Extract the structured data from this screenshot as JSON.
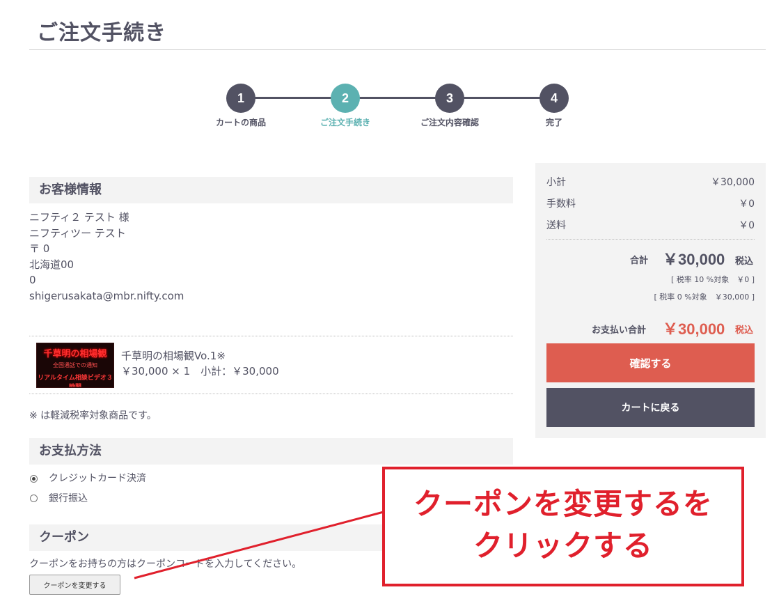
{
  "page": {
    "title": "ご注文手続き"
  },
  "stepper": {
    "steps": [
      {
        "num": "1",
        "label": "カートの商品"
      },
      {
        "num": "2",
        "label": "ご注文手続き"
      },
      {
        "num": "3",
        "label": "ご注文内容確認"
      },
      {
        "num": "4",
        "label": "完了"
      }
    ],
    "active_index": 1
  },
  "customer": {
    "heading": "お客様情報",
    "lines": [
      "ニフティ２ テスト 様",
      "ニフティツー テスト",
      "〒 0",
      "北海道00",
      "0",
      "shigerusakata@mbr.nifty.com"
    ]
  },
  "product": {
    "thumb_title": "千草明の相場観",
    "thumb_sub": "全国通話での通知",
    "thumb_bottom": "リアルタイム相談ビデオ３時間",
    "name": "千草明の相場観Vo.1※",
    "price_line": "￥30,000 × 1　小計：￥30,000",
    "note": "※ は軽減税率対象商品です。"
  },
  "payment": {
    "heading": "お支払方法",
    "options": [
      {
        "label": "クレジットカード決済",
        "checked": true
      },
      {
        "label": "銀行振込",
        "checked": false
      }
    ]
  },
  "coupon": {
    "heading": "クーポン",
    "description": "クーポンをお持ちの方はクーポンコードを入力してください。",
    "button_label": "クーポンを変更する"
  },
  "summary": {
    "subtotal_label": "小計",
    "subtotal_value": "￥30,000",
    "fee_label": "手数料",
    "fee_value": "￥0",
    "shipping_label": "送料",
    "shipping_value": "￥0",
    "total_label": "合計",
    "total_value": "￥30,000",
    "total_suffix": "税込",
    "tax10": "[ 税率 10 %対象　￥0 ]",
    "tax0": "[ 税率 0 %対象　￥30,000 ]",
    "pay_total_label": "お支払い合計",
    "pay_total_value": "￥30,000",
    "pay_total_suffix": "税込",
    "confirm_label": "確認する",
    "back_label": "カートに戻る"
  },
  "annotation": {
    "line1": "クーポンを変更するを",
    "line2": "クリックする"
  },
  "colors": {
    "accent_teal": "#5cb1b1",
    "confirm_red": "#de5d50",
    "dark": "#525263",
    "annotation_red": "#e0202c"
  }
}
